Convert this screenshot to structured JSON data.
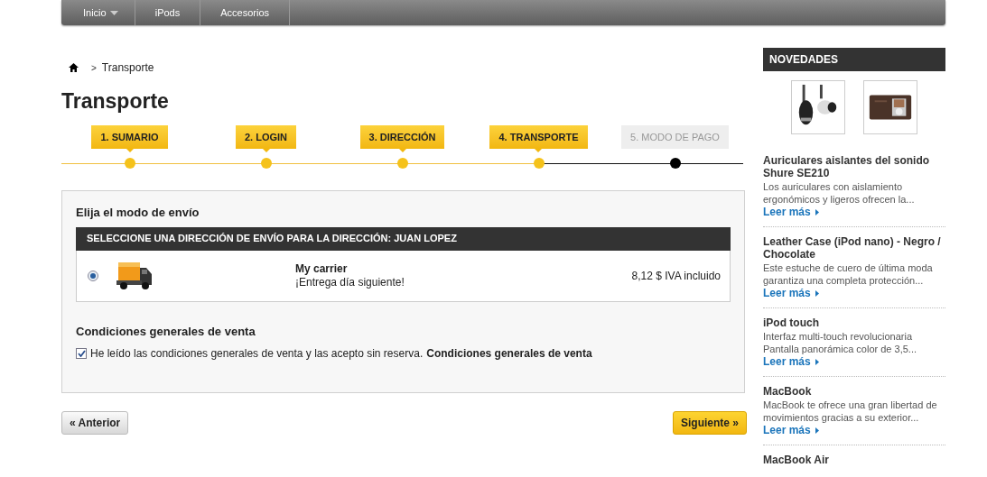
{
  "nav": [
    {
      "label": "Inicio",
      "dropdown": true
    },
    {
      "label": "iPods",
      "dropdown": false
    },
    {
      "label": "Accesorios",
      "dropdown": false
    }
  ],
  "breadcrumb": {
    "separator": ">",
    "current": "Transporte"
  },
  "title": "Transporte",
  "steps": [
    {
      "label": "1. SUMARIO",
      "completed": true
    },
    {
      "label": "2. LOGIN",
      "completed": true
    },
    {
      "label": "3. DIRECCIÓN",
      "completed": true
    },
    {
      "label": "4. TRANSPORTE",
      "completed": true
    },
    {
      "label": "5. MODO DE PAGO",
      "completed": false
    }
  ],
  "shipping": {
    "heading": "Elija el modo de envío",
    "bar": "SELECCIONE UNA DIRECCIÓN DE ENVÍO PARA LA DIRECCIÓN: JUAN LOPEZ",
    "carriers": [
      {
        "name": "My carrier",
        "delay": "¡Entrega día siguiente!",
        "price": "8,12 $ IVA incluido",
        "selected": true
      }
    ]
  },
  "terms": {
    "heading": "Condiciones generales de venta",
    "checked": true,
    "text": "He leído las condiciones generales de venta y las acepto sin reserva.",
    "link": "Condiciones generales de venta"
  },
  "buttons": {
    "previous": "« Anterior",
    "next": "Siguiente »"
  },
  "sidebar": {
    "title": "NOVEDADES",
    "products": [
      {
        "name": "Auriculares aislantes del sonido Shure SE210",
        "description": "Los auriculares con aislamiento ergonómicos y ligeros ofrecen la...",
        "link": "Leer más"
      },
      {
        "name": "Leather Case (iPod nano) - Negro / Chocolate",
        "description": "Este estuche de cuero de última moda garantiza una completa protección...",
        "link": "Leer más"
      },
      {
        "name": "iPod touch",
        "description": "Interfaz multi-touch revolucionaria Pantalla panorámica color de 3,5...",
        "link": "Leer más"
      },
      {
        "name": "MacBook",
        "description": "MacBook te ofrece una gran libertad de movimientos gracias a su exterior...",
        "link": "Leer más"
      },
      {
        "name": "MacBook Air"
      }
    ]
  }
}
